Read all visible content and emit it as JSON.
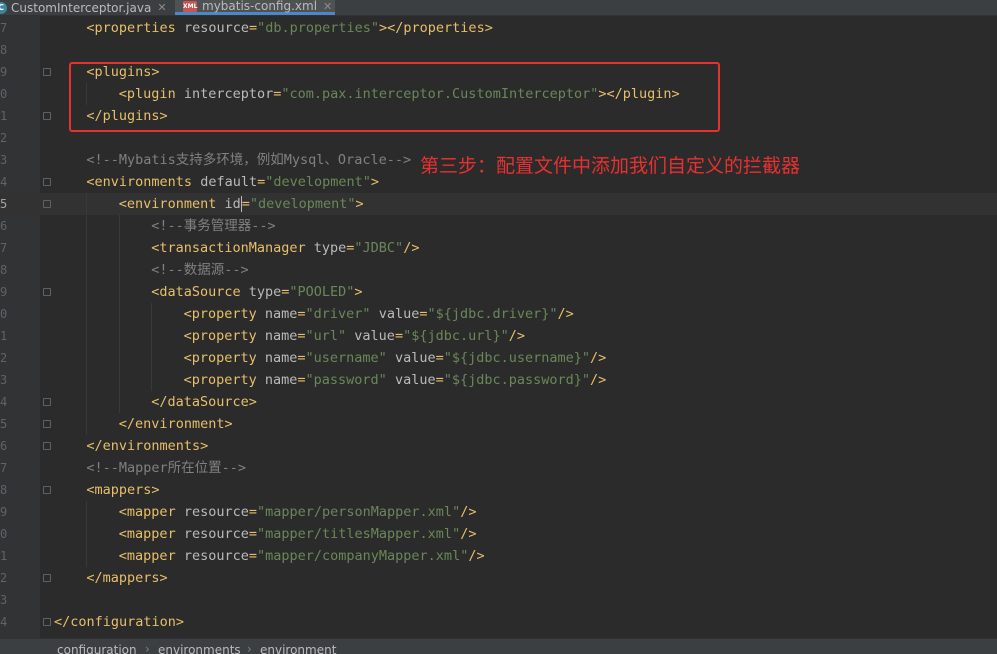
{
  "tabs": [
    {
      "label": "CustomInterceptor.java",
      "icon": "java-class-icon",
      "active": false
    },
    {
      "label": "mybatis-config.xml",
      "icon": "xml-file-icon",
      "active": true
    }
  ],
  "lines": [
    {
      "num": "7",
      "fold": false,
      "indent": 2,
      "tokens": [
        [
          "tag",
          "<properties "
        ],
        [
          "attr",
          "resource"
        ],
        [
          "tag",
          "="
        ],
        [
          "val",
          "\"db.properties\""
        ],
        [
          "tag",
          "></properties>"
        ]
      ]
    },
    {
      "num": "8",
      "fold": false,
      "indent": 0,
      "tokens": []
    },
    {
      "num": "9",
      "fold": true,
      "indent": 2,
      "tokens": [
        [
          "tag",
          "<plugins>"
        ]
      ]
    },
    {
      "num": "0",
      "fold": false,
      "indent": 4,
      "tokens": [
        [
          "tag",
          "<plugin "
        ],
        [
          "attr",
          "interceptor"
        ],
        [
          "tag",
          "="
        ],
        [
          "val",
          "\"com.pax.interceptor.CustomInterceptor\""
        ],
        [
          "tag",
          "></plugin>"
        ]
      ]
    },
    {
      "num": "1",
      "fold": true,
      "indent": 2,
      "tokens": [
        [
          "tag",
          "</plugins>"
        ]
      ]
    },
    {
      "num": "2",
      "fold": false,
      "indent": 0,
      "tokens": []
    },
    {
      "num": "3",
      "fold": false,
      "indent": 2,
      "tokens": [
        [
          "cmt",
          "<!--Mybatis支持多环境，例如Mysql、Oracle-->"
        ]
      ]
    },
    {
      "num": "4",
      "fold": true,
      "indent": 2,
      "tokens": [
        [
          "tag",
          "<environments "
        ],
        [
          "attr",
          "default"
        ],
        [
          "tag",
          "="
        ],
        [
          "val",
          "\"development\""
        ],
        [
          "tag",
          ">"
        ]
      ]
    },
    {
      "num": "5",
      "fold": true,
      "indent": 4,
      "current": true,
      "tokens": [
        [
          "tag",
          "<environment "
        ],
        [
          "attr",
          "id"
        ],
        [
          "caret",
          ""
        ],
        [
          "tag",
          "="
        ],
        [
          "val",
          "\"development\""
        ],
        [
          "tag",
          ">"
        ]
      ]
    },
    {
      "num": "6",
      "fold": false,
      "indent": 6,
      "tokens": [
        [
          "cmt",
          "<!--事务管理器-->"
        ]
      ]
    },
    {
      "num": "7",
      "fold": false,
      "indent": 6,
      "tokens": [
        [
          "tag",
          "<transactionManager "
        ],
        [
          "attr",
          "type"
        ],
        [
          "tag",
          "="
        ],
        [
          "val",
          "\"JDBC\""
        ],
        [
          "tag",
          "/>"
        ]
      ]
    },
    {
      "num": "8",
      "fold": false,
      "indent": 6,
      "tokens": [
        [
          "cmt",
          "<!--数据源-->"
        ]
      ]
    },
    {
      "num": "9",
      "fold": true,
      "indent": 6,
      "tokens": [
        [
          "tag",
          "<dataSource "
        ],
        [
          "attr",
          "type"
        ],
        [
          "tag",
          "="
        ],
        [
          "val",
          "\"POOLED\""
        ],
        [
          "tag",
          ">"
        ]
      ]
    },
    {
      "num": "0",
      "fold": false,
      "indent": 8,
      "tokens": [
        [
          "tag",
          "<property "
        ],
        [
          "attr",
          "name"
        ],
        [
          "tag",
          "="
        ],
        [
          "val",
          "\"driver\""
        ],
        [
          "attr",
          " value"
        ],
        [
          "tag",
          "="
        ],
        [
          "val",
          "\"${jdbc.driver}\""
        ],
        [
          "tag",
          "/>"
        ]
      ]
    },
    {
      "num": "1",
      "fold": false,
      "indent": 8,
      "tokens": [
        [
          "tag",
          "<property "
        ],
        [
          "attr",
          "name"
        ],
        [
          "tag",
          "="
        ],
        [
          "val",
          "\"url\""
        ],
        [
          "attr",
          " value"
        ],
        [
          "tag",
          "="
        ],
        [
          "val",
          "\"${jdbc.url}\""
        ],
        [
          "tag",
          "/>"
        ]
      ]
    },
    {
      "num": "2",
      "fold": false,
      "indent": 8,
      "tokens": [
        [
          "tag",
          "<property "
        ],
        [
          "attr",
          "name"
        ],
        [
          "tag",
          "="
        ],
        [
          "val",
          "\"username\""
        ],
        [
          "attr",
          " value"
        ],
        [
          "tag",
          "="
        ],
        [
          "val",
          "\"${jdbc.username}\""
        ],
        [
          "tag",
          "/>"
        ]
      ]
    },
    {
      "num": "3",
      "fold": false,
      "indent": 8,
      "tokens": [
        [
          "tag",
          "<property "
        ],
        [
          "attr",
          "name"
        ],
        [
          "tag",
          "="
        ],
        [
          "val",
          "\"password\""
        ],
        [
          "attr",
          " value"
        ],
        [
          "tag",
          "="
        ],
        [
          "val",
          "\"${jdbc.password}\""
        ],
        [
          "tag",
          "/>"
        ]
      ]
    },
    {
      "num": "4",
      "fold": true,
      "indent": 6,
      "tokens": [
        [
          "tag",
          "</dataSource>"
        ]
      ]
    },
    {
      "num": "5",
      "fold": true,
      "indent": 4,
      "tokens": [
        [
          "tag",
          "</environment>"
        ]
      ]
    },
    {
      "num": "6",
      "fold": true,
      "indent": 2,
      "tokens": [
        [
          "tag",
          "</environments>"
        ]
      ]
    },
    {
      "num": "7",
      "fold": false,
      "indent": 2,
      "tokens": [
        [
          "cmt",
          "<!--Mapper所在位置-->"
        ]
      ]
    },
    {
      "num": "8",
      "fold": true,
      "indent": 2,
      "tokens": [
        [
          "tag",
          "<mappers>"
        ]
      ]
    },
    {
      "num": "9",
      "fold": false,
      "indent": 4,
      "tokens": [
        [
          "tag",
          "<mapper "
        ],
        [
          "attr",
          "resource"
        ],
        [
          "tag",
          "="
        ],
        [
          "val",
          "\"mapper/personMapper.xml\""
        ],
        [
          "tag",
          "/>"
        ]
      ]
    },
    {
      "num": "0",
      "fold": false,
      "indent": 4,
      "tokens": [
        [
          "tag",
          "<mapper "
        ],
        [
          "attr",
          "resource"
        ],
        [
          "tag",
          "="
        ],
        [
          "val",
          "\"mapper/titlesMapper.xml\""
        ],
        [
          "tag",
          "/>"
        ]
      ]
    },
    {
      "num": "1",
      "fold": false,
      "indent": 4,
      "tokens": [
        [
          "tag",
          "<mapper "
        ],
        [
          "attr",
          "resource"
        ],
        [
          "tag",
          "="
        ],
        [
          "val",
          "\"mapper/companyMapper.xml\""
        ],
        [
          "tag",
          "/>"
        ]
      ]
    },
    {
      "num": "2",
      "fold": true,
      "indent": 2,
      "tokens": [
        [
          "tag",
          "</mappers>"
        ]
      ]
    },
    {
      "num": "3",
      "fold": false,
      "indent": 0,
      "tokens": []
    },
    {
      "num": "4",
      "fold": true,
      "indent": 0,
      "tokens": [
        [
          "tag",
          "</configuration>"
        ]
      ]
    }
  ],
  "annotation": "第三步：配置文件中添加我们自定义的拦截器",
  "breadcrumb": [
    "configuration",
    "environments",
    "environment"
  ],
  "colors": {
    "tag": "#e8bf6a",
    "attribute": "#bababa",
    "value": "#6a8759",
    "comment": "#808080",
    "highlight": "#e83030"
  }
}
